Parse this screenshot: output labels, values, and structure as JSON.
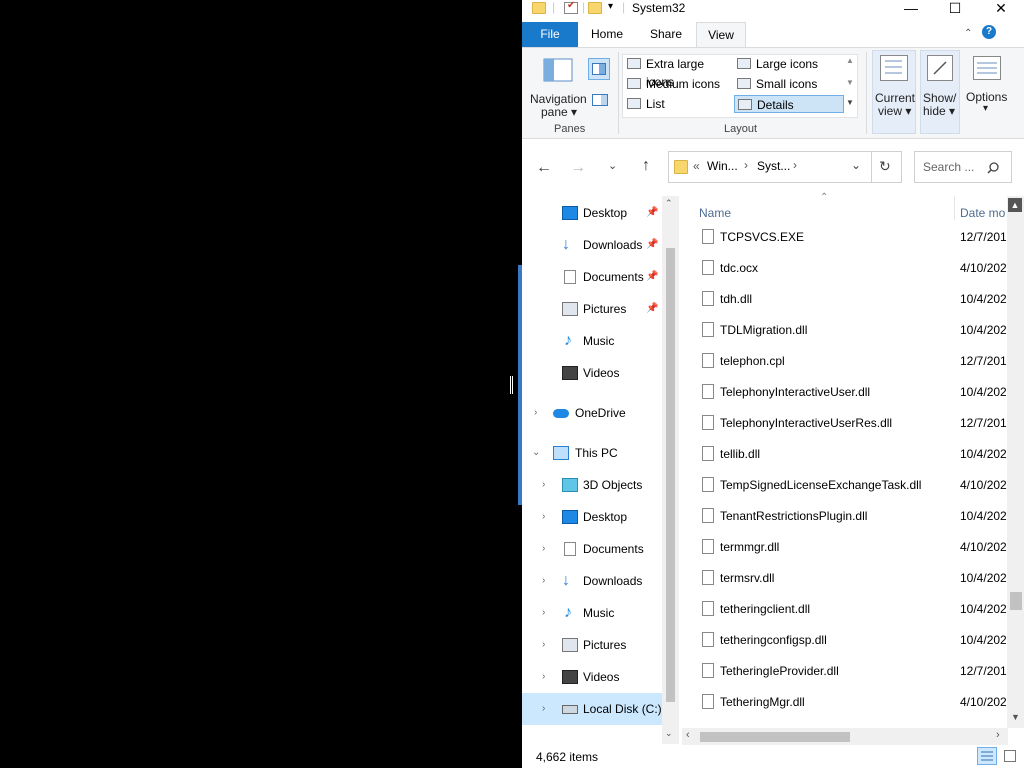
{
  "window": {
    "title": "System32"
  },
  "window_controls": {
    "minimize": "—",
    "maximize": "☐",
    "close": "✕"
  },
  "ribbon_tabs": [
    "File",
    "Home",
    "Share",
    "View"
  ],
  "ribbon": {
    "panes": {
      "navigation_pane_line1": "Navigation",
      "navigation_pane_line2": "pane ▾",
      "caption": "Panes"
    },
    "layout": {
      "items": [
        "Extra large icons",
        "Large icons",
        "Medium icons",
        "Small icons",
        "List",
        "Details"
      ],
      "selected": "Details",
      "caption": "Layout"
    },
    "current_view": {
      "line1": "Current",
      "line2": "view ▾"
    },
    "show_hide": {
      "line1": "Show/",
      "line2": "hide ▾"
    },
    "options": {
      "label": "Options",
      "arrow": "▾"
    }
  },
  "address": {
    "prefix": "«",
    "crumbs": [
      "Win...",
      "Syst..."
    ],
    "separator": "›",
    "search_placeholder": "Search ..."
  },
  "nav_pane": {
    "quick_access": [
      {
        "label": "Desktop",
        "icon": "desktop-icon",
        "pinned": true
      },
      {
        "label": "Downloads",
        "icon": "download-icon",
        "pinned": true
      },
      {
        "label": "Documents",
        "icon": "documents-icon",
        "pinned": true
      },
      {
        "label": "Pictures",
        "icon": "pictures-icon",
        "pinned": true
      },
      {
        "label": "Music",
        "icon": "music-icon",
        "pinned": false
      },
      {
        "label": "Videos",
        "icon": "videos-icon",
        "pinned": false
      }
    ],
    "onedrive": "OneDrive",
    "this_pc": "This PC",
    "this_pc_children": [
      "3D Objects",
      "Desktop",
      "Documents",
      "Downloads",
      "Music",
      "Pictures",
      "Videos",
      "Local Disk (C:)"
    ],
    "selected": "Local Disk (C:)"
  },
  "columns": {
    "name": "Name",
    "date": "Date mo"
  },
  "files": [
    {
      "name": "TCPSVCS.EXE",
      "date": "12/7/201"
    },
    {
      "name": "tdc.ocx",
      "date": "4/10/202"
    },
    {
      "name": "tdh.dll",
      "date": "10/4/202"
    },
    {
      "name": "TDLMigration.dll",
      "date": "10/4/202"
    },
    {
      "name": "telephon.cpl",
      "date": "12/7/201"
    },
    {
      "name": "TelephonyInteractiveUser.dll",
      "date": "10/4/202"
    },
    {
      "name": "TelephonyInteractiveUserRes.dll",
      "date": "12/7/201"
    },
    {
      "name": "tellib.dll",
      "date": "10/4/202"
    },
    {
      "name": "TempSignedLicenseExchangeTask.dll",
      "date": "4/10/202"
    },
    {
      "name": "TenantRestrictionsPlugin.dll",
      "date": "10/4/202"
    },
    {
      "name": "termmgr.dll",
      "date": "4/10/202"
    },
    {
      "name": "termsrv.dll",
      "date": "10/4/202"
    },
    {
      "name": "tetheringclient.dll",
      "date": "10/4/202"
    },
    {
      "name": "tetheringconfigsp.dll",
      "date": "10/4/202"
    },
    {
      "name": "TetheringIeProvider.dll",
      "date": "12/7/201"
    },
    {
      "name": "TetheringMgr.dll",
      "date": "4/10/202"
    }
  ],
  "status": {
    "item_count": "4,662 items"
  },
  "colors": {
    "accent": "#1979ca",
    "selection": "#cce8ff",
    "ribbon_bg": "#f5f6f7"
  }
}
